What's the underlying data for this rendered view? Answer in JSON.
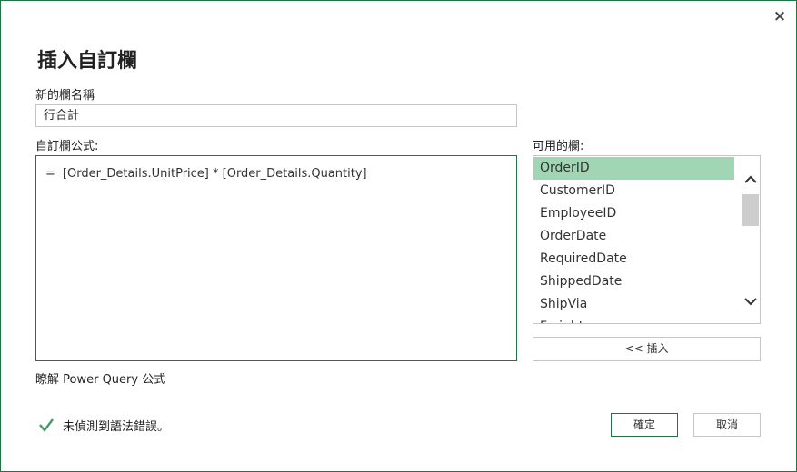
{
  "dialog": {
    "title": "插入自訂欄",
    "close_glyph": "×"
  },
  "name": {
    "label": "新的欄名稱",
    "value": "行合計"
  },
  "formula": {
    "label": "自訂欄公式:",
    "eq": "=",
    "value": "[Order_Details.UnitPrice] * [Order_Details.Quantity]"
  },
  "columns": {
    "label": "可用的欄:",
    "items": [
      {
        "label": "OrderID"
      },
      {
        "label": "CustomerID"
      },
      {
        "label": "EmployeeID"
      },
      {
        "label": "OrderDate"
      },
      {
        "label": "RequiredDate"
      },
      {
        "label": "ShippedDate"
      },
      {
        "label": "ShipVia"
      },
      {
        "label": "Freight"
      }
    ],
    "selected": "OrderID"
  },
  "insert_button": "<< 插入",
  "learn_link": "瞭解 Power Query 公式",
  "status": {
    "text": "未偵測到語法錯誤。",
    "icon": "check-icon",
    "color": "#4a9b6b"
  },
  "buttons": {
    "ok": "確定",
    "cancel": "取消"
  },
  "colors": {
    "accent": "#217346",
    "selection": "#a0d6b4"
  }
}
